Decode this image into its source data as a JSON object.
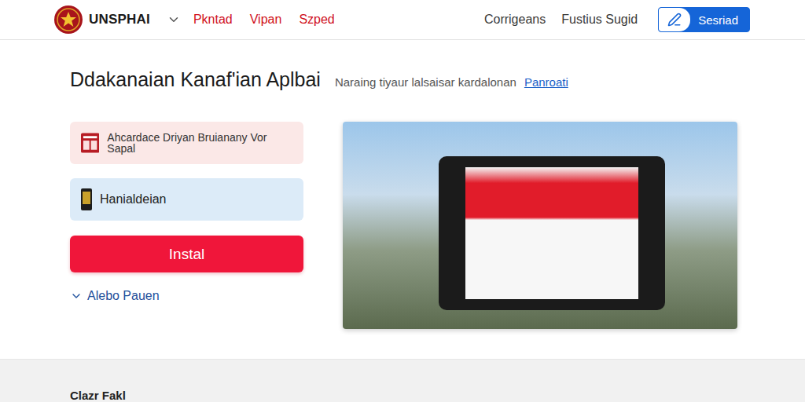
{
  "header": {
    "logo": "UNSPHAI",
    "nav": [
      "Pkntad",
      "Vipan",
      "Szped"
    ],
    "links": [
      "Corrigeans",
      "Fustius Sugid"
    ],
    "button": "Sesriad"
  },
  "page": {
    "title": "Ddakanaian Kanaf'ian Aplbai",
    "subtitle": "Naraing tiyaur lalsaisar kardalonan",
    "link": "Panroati"
  },
  "options": [
    {
      "label": "Ahcardace Driyan Bruianany Vor Sapal",
      "kind": "document",
      "color": "#fbe8e7"
    },
    {
      "label": "Hanialdeian",
      "kind": "phone",
      "color": "#dcebf8"
    }
  ],
  "install_button": "Instal",
  "more_link": "Alebo Pauen",
  "footer": {
    "heading": "Clazr Fakl"
  }
}
